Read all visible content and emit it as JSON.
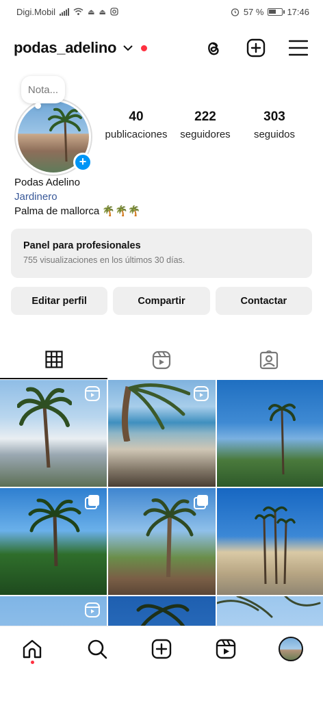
{
  "status_bar": {
    "carrier": "Digi.Mobil",
    "battery": "57 %",
    "time": "17:46"
  },
  "header": {
    "username": "podas_adelino",
    "icons": [
      "threads-icon",
      "create-icon",
      "menu-icon"
    ]
  },
  "profile": {
    "note_placeholder": "Nota...",
    "stats": [
      {
        "value": "40",
        "label": "publicaciones"
      },
      {
        "value": "222",
        "label": "seguidores"
      },
      {
        "value": "303",
        "label": "seguidos"
      }
    ],
    "name": "Podas Adelino",
    "category": "Jardinero",
    "bio": "Palma de mallorca 🌴🌴🌴"
  },
  "panel": {
    "title": "Panel para profesionales",
    "subtitle": "755 visualizaciones en los últimos 30 días."
  },
  "buttons": {
    "edit": "Editar perfil",
    "share": "Compartir",
    "contact": "Contactar"
  },
  "tabs": [
    "grid-icon",
    "reels-icon",
    "tagged-icon"
  ],
  "bottom_nav": [
    "home-icon",
    "search-icon",
    "create-icon",
    "reels-icon",
    "profile-avatar"
  ],
  "colors": {
    "accent": "#0095f6",
    "notification": "#ff3040",
    "link": "#385898",
    "button_bg": "#efefef"
  }
}
